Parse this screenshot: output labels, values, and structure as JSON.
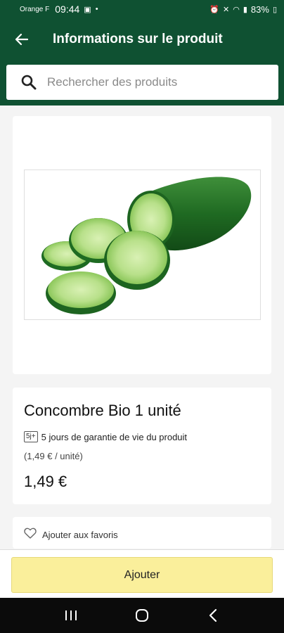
{
  "status_bar": {
    "carrier": "Orange F",
    "time": "09:44",
    "battery": "83%"
  },
  "header": {
    "title": "Informations sur le produit"
  },
  "search": {
    "placeholder": "Rechercher des produits"
  },
  "product": {
    "name": "Concombre Bio 1 unité",
    "guarantee_badge": "5j+",
    "guarantee_text": "5 jours de garantie de vie du produit",
    "unit_price": "(1,49 € / unité)",
    "price": "1,49 €",
    "image": "cucumber-photo"
  },
  "favorites": {
    "label": "Ajouter aux favoris"
  },
  "actions": {
    "add_label": "Ajouter"
  },
  "icons": {
    "back": "arrow-left-icon",
    "search": "search-icon",
    "favorite": "heart-outline-icon",
    "nav_recents": "recents-icon",
    "nav_home": "home-icon",
    "nav_back": "nav-back-icon"
  },
  "colors": {
    "brand_green": "#0f5132",
    "add_button": "#faef9b",
    "background": "#f4f4f4"
  }
}
